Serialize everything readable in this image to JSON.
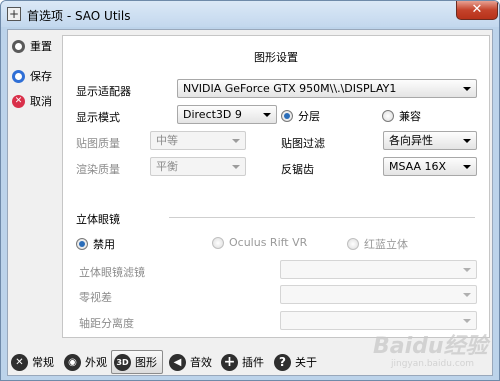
{
  "window": {
    "title": "首选项 - SAO Utils",
    "close_label": "✕"
  },
  "sidebar": {
    "items": [
      {
        "label": "重置",
        "icon": "reset-icon",
        "color": "#5a5a5a"
      },
      {
        "label": "保存",
        "icon": "save-icon",
        "color": "#2f6fd6"
      },
      {
        "label": "取消",
        "icon": "cancel-icon",
        "color": "#d9304a"
      }
    ]
  },
  "panel": {
    "title": "图形设置",
    "adapter": {
      "label": "显示适配器",
      "value": "NVIDIA GeForce GTX 950M\\\\.\\DISPLAY1"
    },
    "display_mode": {
      "label": "显示模式",
      "value": "Direct3D 9",
      "option_layered": "分层",
      "option_compatible": "兼容",
      "selected": "分层"
    },
    "texture_quality": {
      "label": "贴图质量",
      "value": "中等"
    },
    "texture_filter": {
      "label": "贴图过滤",
      "value": "各向异性"
    },
    "render_quality": {
      "label": "渲染质量",
      "value": "平衡"
    },
    "antialiasing": {
      "label": "反锯齿",
      "value": "MSAA 16X"
    },
    "stereo": {
      "section_label": "立体眼镜",
      "option_disabled": "禁用",
      "option_oculus": "Oculus Rift VR",
      "option_anaglyph": "红蓝立体",
      "selected": "禁用",
      "filter_label": "立体眼镜滤镜",
      "parallax_label": "零视差",
      "ipd_label": "轴距分离度"
    }
  },
  "toolbar": {
    "items": [
      {
        "label": "常规",
        "icon": "wrench-icon"
      },
      {
        "label": "外观",
        "icon": "eye-icon"
      },
      {
        "label": "图形",
        "icon": "3d-icon",
        "icon_text": "3D",
        "active": true
      },
      {
        "label": "音效",
        "icon": "speaker-icon"
      },
      {
        "label": "插件",
        "icon": "plus-icon",
        "icon_text": "+"
      },
      {
        "label": "关于",
        "icon": "question-icon",
        "icon_text": "?"
      }
    ]
  },
  "watermark": {
    "text": "Baidu经验",
    "subtext": "jingyan.baidu.com"
  }
}
